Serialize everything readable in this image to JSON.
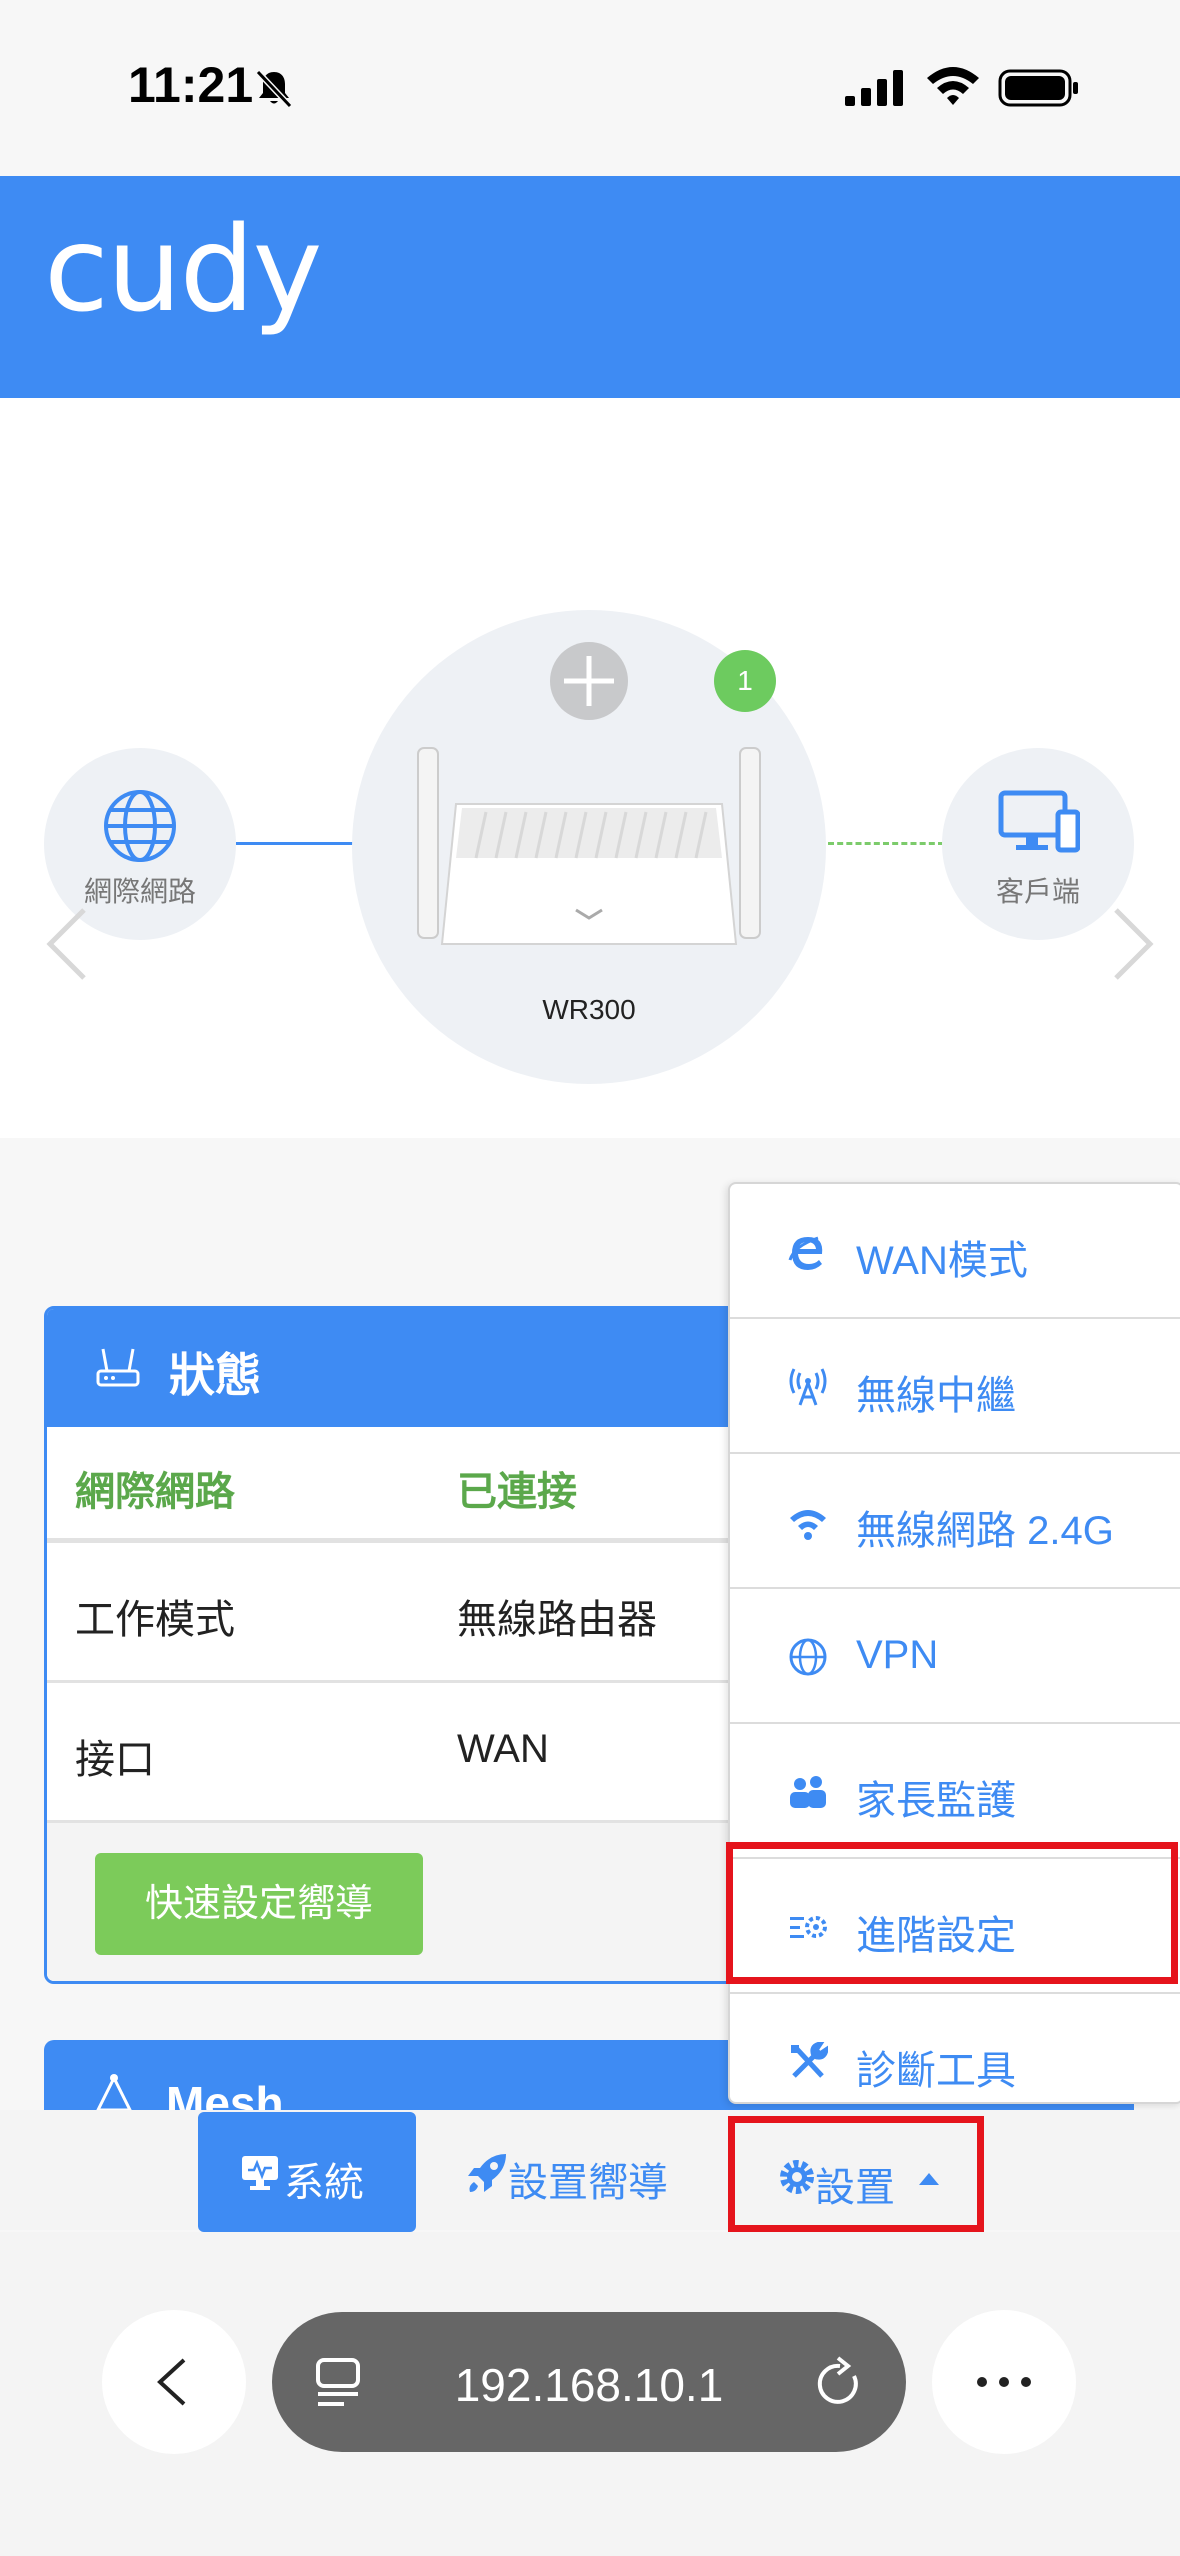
{
  "status_bar": {
    "time": "11:21"
  },
  "header": {
    "logo": "cudy"
  },
  "topology": {
    "internet_label": "網際網路",
    "client_label": "客戶端",
    "router_model": "WR300",
    "client_count": "1"
  },
  "status_card": {
    "title": "狀態",
    "rows": [
      {
        "key": "網際網路",
        "value": "已連接"
      },
      {
        "key": "工作模式",
        "value": "無線路由器"
      },
      {
        "key": "接口",
        "value": "WAN"
      }
    ],
    "quick_setup_label": "快速設定嚮導"
  },
  "mesh_card": {
    "title": "Mesh"
  },
  "dropdown": {
    "items": [
      {
        "label": "WAN模式",
        "icon": "ie-icon"
      },
      {
        "label": "無線中繼",
        "icon": "antenna-icon"
      },
      {
        "label": "無線網路 2.4G",
        "icon": "wifi-icon"
      },
      {
        "label": "VPN",
        "icon": "globe-icon"
      },
      {
        "label": "家長監護",
        "icon": "users-icon"
      },
      {
        "label": "進階設定",
        "icon": "advanced-settings-icon"
      },
      {
        "label": "診斷工具",
        "icon": "tools-icon"
      }
    ],
    "highlighted": "進階設定"
  },
  "bottom_nav": {
    "system_label": "系統",
    "wizard_label": "設置嚮導",
    "settings_label": "設置"
  },
  "browser": {
    "url": "192.168.10.1"
  },
  "colors": {
    "primary": "#3e8bf3",
    "success": "#7ccb5a",
    "highlight": "#e5141c"
  }
}
